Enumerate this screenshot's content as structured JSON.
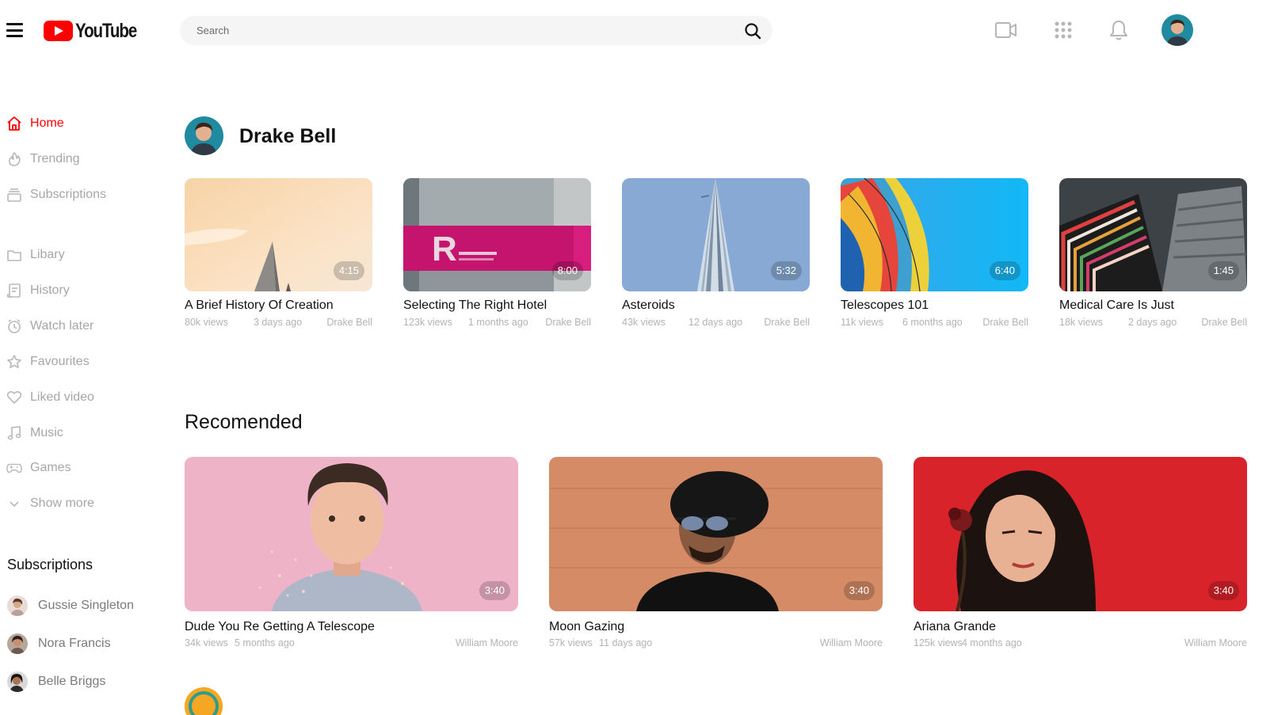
{
  "header": {
    "logo_text": "YouTube",
    "search_placeholder": "Search",
    "icons": [
      "menu-icon",
      "search-icon",
      "video-camera-icon",
      "apps-grid-icon",
      "bell-icon"
    ]
  },
  "sidebar": {
    "nav": [
      {
        "label": "Home",
        "icon": "home-icon",
        "active": true
      },
      {
        "label": "Trending",
        "icon": "flame-icon"
      },
      {
        "label": "Subscriptions",
        "icon": "subscriptions-icon"
      },
      {
        "label": "Libary",
        "icon": "folder-icon"
      },
      {
        "label": "History",
        "icon": "history-icon"
      },
      {
        "label": "Watch later",
        "icon": "clock-icon"
      },
      {
        "label": "Favourites",
        "icon": "star-icon"
      },
      {
        "label": "Liked video",
        "icon": "heart-icon"
      },
      {
        "label": "Music",
        "icon": "music-icon"
      },
      {
        "label": "Games",
        "icon": "gamepad-icon"
      },
      {
        "label": "Show more",
        "icon": "chevron-down-icon"
      }
    ],
    "subscriptions_title": "Subscriptions",
    "subscriptions": [
      {
        "name": "Gussie Singleton"
      },
      {
        "name": "Nora Francis"
      },
      {
        "name": "Belle Briggs"
      }
    ]
  },
  "channel": {
    "name": "Drake Bell",
    "videos": [
      {
        "title": "A Brief History Of Creation",
        "views": "80k views",
        "age": "3 days ago",
        "author": "Drake Bell",
        "duration": "4:15"
      },
      {
        "title": "Selecting The Right Hotel",
        "views": "123k views",
        "age": "1 months ago",
        "author": "Drake Bell",
        "duration": "8:00"
      },
      {
        "title": "Asteroids",
        "views": "43k views",
        "age": "12 days ago",
        "author": "Drake Bell",
        "duration": "5:32"
      },
      {
        "title": "Telescopes 101",
        "views": "11k views",
        "age": "6 months ago",
        "author": "Drake Bell",
        "duration": "6:40"
      },
      {
        "title": "Medical Care Is Just",
        "views": "18k views",
        "age": "2 days ago",
        "author": "Drake Bell",
        "duration": "1:45"
      }
    ]
  },
  "recommended": {
    "title": "Recomended",
    "videos": [
      {
        "title": "Dude You Re Getting A Telescope",
        "views": "34k views",
        "age": "5 months ago",
        "author": "William Moore",
        "duration": "3:40"
      },
      {
        "title": "Moon Gazing",
        "views": "57k views",
        "age": "11 days ago",
        "author": "William Moore",
        "duration": "3:40"
      },
      {
        "title": "Ariana Grande",
        "views": "125k views",
        "age": "4 months ago",
        "author": "William Moore",
        "duration": "3:40"
      }
    ]
  },
  "colors": {
    "accent": "#ff0000",
    "muted": "#a6a6a6",
    "search_bg": "#f5f5f5"
  }
}
